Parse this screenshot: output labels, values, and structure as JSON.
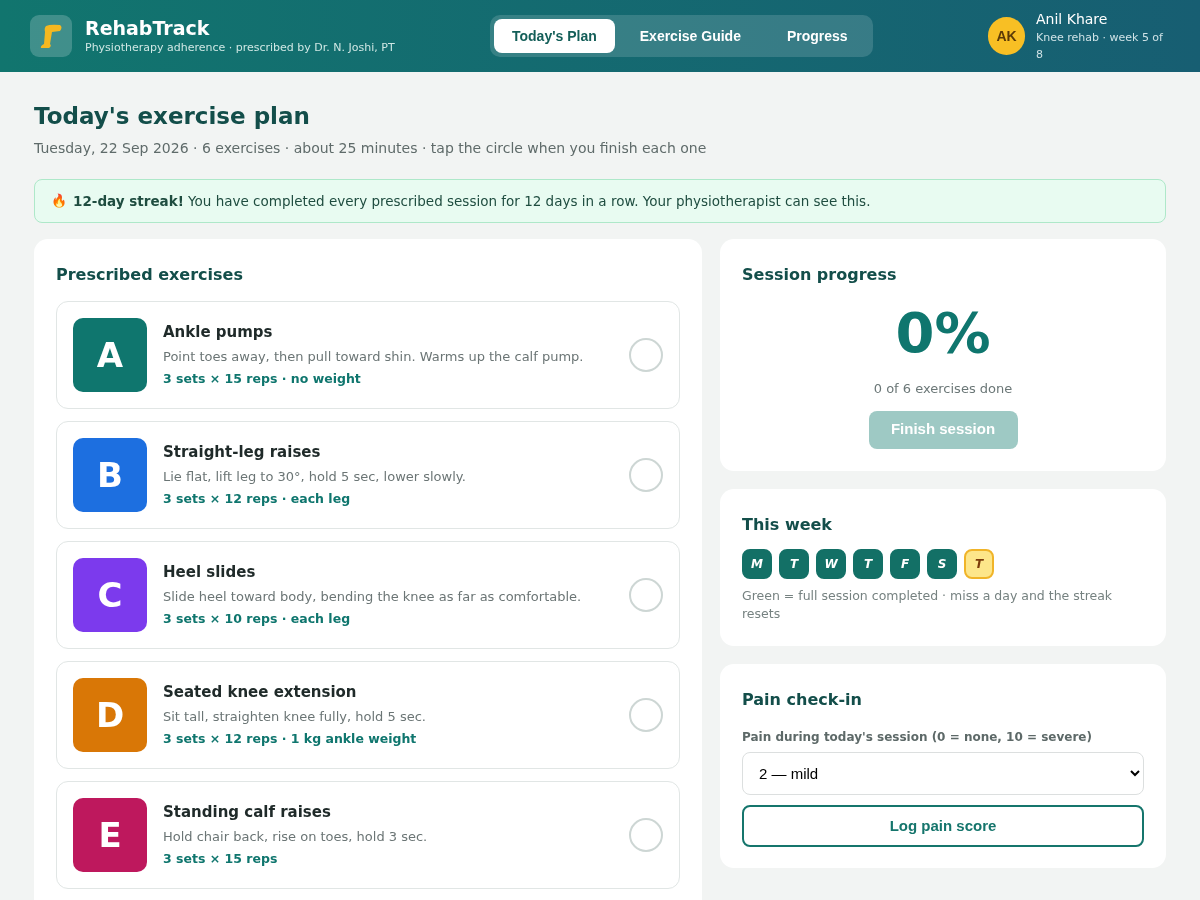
{
  "header": {
    "app_name": "RehabTrack",
    "subtitle": "Physiotherapy adherence · prescribed by Dr. N. Joshi, PT",
    "tabs": [
      {
        "label": "Today's Plan",
        "selected": true
      },
      {
        "label": "Exercise Guide",
        "selected": false
      },
      {
        "label": "Progress",
        "selected": false
      }
    ],
    "user": {
      "initials": "AK",
      "name": "Anil Khare",
      "detail": "Knee rehab · week 5 of 8"
    }
  },
  "page": {
    "title": "Today's exercise plan",
    "subtitle": "Tuesday, 22 Sep 2026 · 6 exercises · about 25 minutes · tap the circle when you finish each one"
  },
  "streak_banner": {
    "icon": "🔥",
    "text": "**12-day streak!** You have completed every prescribed session for 12 days in a row. Your physiotherapist can see this."
  },
  "exercises": {
    "title": "Prescribed exercises",
    "items": [
      {
        "letter": "A",
        "name": "Ankle pumps",
        "description": "Point toes away, then pull toward shin. Warms up the calf pump.",
        "dose": "3 sets × 15 reps · no weight",
        "color": "#0f766e",
        "checked": false
      },
      {
        "letter": "B",
        "name": "Straight-leg raises",
        "description": "Lie flat, lift leg to 30°, hold 5 sec, lower slowly.",
        "dose": "3 sets × 12 reps · each leg",
        "color": "#1d6fe0",
        "checked": false
      },
      {
        "letter": "C",
        "name": "Heel slides",
        "description": "Slide heel toward body, bending the knee as far as comfortable.",
        "dose": "3 sets × 10 reps · each leg",
        "color": "#7c3aed",
        "checked": false
      },
      {
        "letter": "D",
        "name": "Seated knee extension",
        "description": "Sit tall, straighten knee fully, hold 5 sec.",
        "dose": "3 sets × 12 reps · 1 kg ankle weight",
        "color": "#d97706",
        "checked": false
      },
      {
        "letter": "E",
        "name": "Standing calf raises",
        "description": "Hold chair back, rise on toes, hold 3 sec.",
        "dose": "3 sets × 15 reps",
        "color": "#be185d",
        "checked": false
      }
    ]
  },
  "session_progress": {
    "title": "Session progress",
    "percent": "0%",
    "caption": "0 of 6 exercises done",
    "button": {
      "label": "Finish session",
      "disabled": true
    }
  },
  "this_week": {
    "title": "This week",
    "days": [
      {
        "label": "M",
        "kind": "done"
      },
      {
        "label": "T",
        "kind": "done"
      },
      {
        "label": "W",
        "kind": "done"
      },
      {
        "label": "T",
        "kind": "done"
      },
      {
        "label": "F",
        "kind": "done"
      },
      {
        "label": "S",
        "kind": "done"
      },
      {
        "label": "T",
        "kind": "today"
      }
    ],
    "caption": "Green = full session completed · miss a day and the streak resets"
  },
  "pain_checkin": {
    "title": "Pain check-in",
    "label": "Pain during today's session (0 = none, 10 = severe)",
    "value": "2 — mild",
    "button": "Log pain score"
  }
}
